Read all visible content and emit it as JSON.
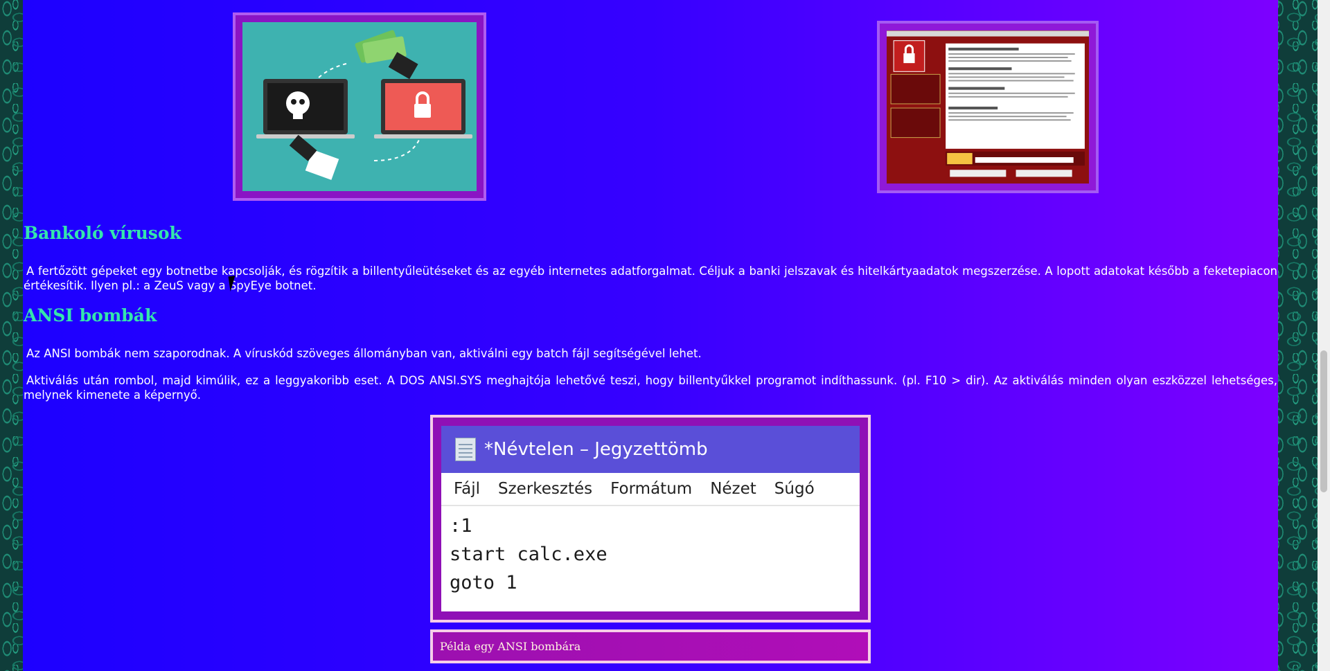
{
  "section_bankolo": {
    "heading": "Bankoló vírusok",
    "paragraph": "A fertőzött gépeket egy botnetbe kapcsolják, és rögzítik a billentyűleütéseket és az egyéb internetes adatforgalmat. Céljuk a banki jelszavak és hitelkártyaadatok megszerzése. A lopott adatokat később a feketepiacon értékesítik. Ilyen pl.: a ZeuS vagy a SpyEye botnet."
  },
  "section_ansi": {
    "heading": "ANSI bombák",
    "paragraph_1": "Az ANSI bombák nem szaporodnak. A víruskód szöveges állományban van, aktiválni egy batch fájl segítségével lehet.",
    "paragraph_2": "Aktiválás után rombol, majd kimúlik, ez a leggyakoribb eset. A DOS ANSI.SYS meghajtója lehetővé teszi, hogy billentyűkkel programot indíthassunk. (pl. F10 > dir). Az aktiválás minden olyan eszközzel lehetséges, melynek kimenete a képernyő."
  },
  "notepad": {
    "title": "*Névtelen – Jegyzettömb",
    "menu": [
      "Fájl",
      "Szerkesztés",
      "Formátum",
      "Nézet",
      "Súgó"
    ],
    "lines": [
      ":1",
      "start calc.exe",
      "goto 1"
    ]
  },
  "caption": "Példa egy ANSI bombára",
  "colors": {
    "heading": "#34e6ac",
    "background_left": "#1d00ff",
    "background_right": "#7d00ff",
    "frame_purple": "#8a14c4"
  }
}
